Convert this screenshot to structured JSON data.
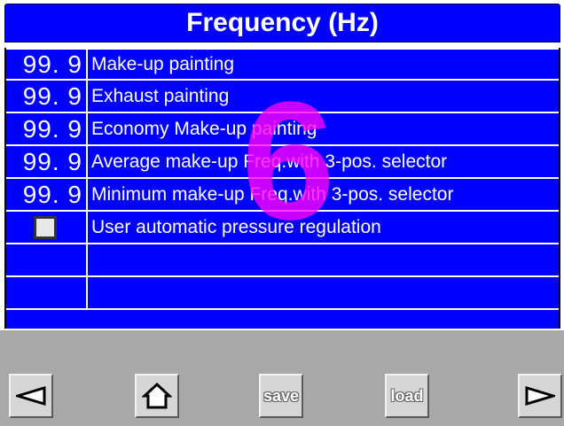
{
  "header": {
    "title": "Frequency (Hz)"
  },
  "overlay": {
    "number": "6"
  },
  "rows": [
    {
      "value": "99. 9",
      "label": "Make-up painting"
    },
    {
      "value": "99. 9",
      "label": "Exhaust painting"
    },
    {
      "value": "99. 9",
      "label": "Economy Make-up painting"
    },
    {
      "value": "99. 9",
      "label": "Average make-up Freq.with 3-pos. selector"
    },
    {
      "value": "99. 9",
      "label": "Minimum make-up Freq.with 3-pos. selector"
    }
  ],
  "checkbox_row": {
    "label": "User automatic pressure regulation",
    "checked": false
  },
  "footer": {
    "prev_icon": "left-arrow-icon",
    "home_icon": "home-icon",
    "save_label": "save",
    "load_label": "load",
    "next_icon": "right-arrow-icon"
  },
  "colors": {
    "table_bg": "#0000ff",
    "text": "#ffffff",
    "overlay": "#ff00ff",
    "footer_bg": "#a8a8a8"
  }
}
